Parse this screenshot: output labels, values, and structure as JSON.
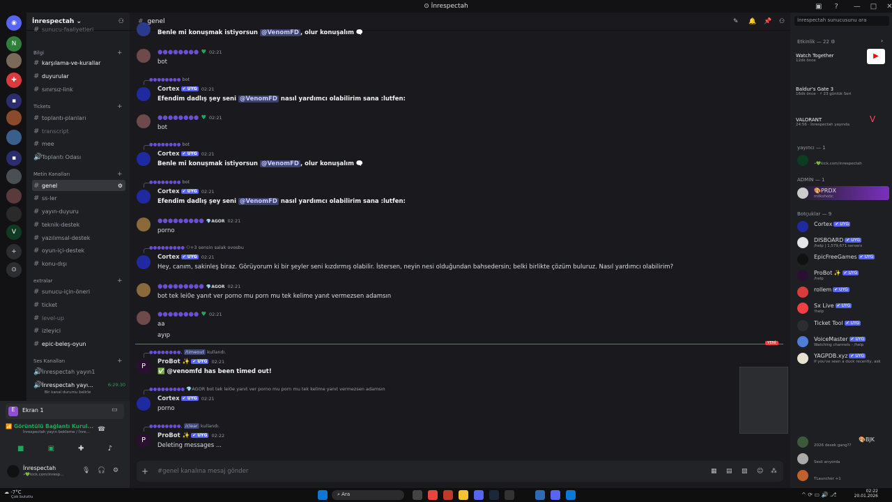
{
  "window": {
    "title": "İnrespectah"
  },
  "server": {
    "name": "İnrespectah ⌄",
    "search_placeholder": "İnrespectah sunucusunu ara"
  },
  "channels": {
    "cut_top": "sunucu-faaliyetleri",
    "categories": [
      {
        "name": "Bilgi",
        "items": [
          "karşılama-ve-kurallar",
          "duyurular",
          "sınırsız-link"
        ]
      },
      {
        "name": "Tickets",
        "items": [
          "toplantı-planları",
          "transcript",
          "mee",
          "Toplantı Odası"
        ]
      },
      {
        "name": "Metin Kanalları",
        "items": [
          "genel",
          "ss-ler",
          "yayın-duyuru",
          "teknik-destek",
          "yazılımsal-destek",
          "oyun-içi-destek",
          "konu-dışı"
        ]
      },
      {
        "name": "extralar",
        "items": [
          "sunucu-için-öneri",
          "ticket",
          "level-up",
          "izleyici",
          "epic-beleş-oyun"
        ]
      },
      {
        "name": "Ses Kanalları",
        "items": [
          "İnrespectah yayın1",
          "İnrespectah yayı..."
        ]
      }
    ],
    "voice_timer": "6:29:30",
    "voice_status": "Bir kanal durumu belirle"
  },
  "screen_share": {
    "label": "Ekran 1"
  },
  "voice_connected": {
    "title": "Görüntülü Bağlantı Kurul...",
    "subtitle": "İnrespectah yayın bekleme / İnre..."
  },
  "user": {
    "name": "İnrespectah",
    "status": "•💚kick.com/inresp..."
  },
  "chat": {
    "channel": "genel",
    "messages": [
      {
        "text": "Benle mi konuşmak istiyorsun ",
        "mention": "@VenomFD",
        "text2": ", olur konuşalım 🗨️"
      },
      {
        "time": "02:21",
        "text": "bot"
      },
      {
        "reply": "bot",
        "author": "Cortex",
        "badge": "✔ UYG",
        "time": "02:21",
        "text": "Efendim dadlış şey seni ",
        "mention": "@VenomFD",
        "text2": " nasıl yardımcı olabilirim sana :lutfen:"
      },
      {
        "time": "02:21",
        "text": "bot"
      },
      {
        "reply": "bot",
        "author": "Cortex",
        "badge": "✔ UYG",
        "time": "02:21",
        "text": "Benle mi konuşmak istiyorsun ",
        "mention": "@VenomFD",
        "text2": ", olur konuşalım 🗨️"
      },
      {
        "reply": "bot",
        "author": "Cortex",
        "badge": "✔ UYG",
        "time": "02:21",
        "text": "Efendim dadlış şey seni ",
        "mention": "@VenomFD",
        "text2": " nasıl yardımcı olabilirim sana :lutfen:"
      },
      {
        "tag": "💎AGOR",
        "time": "02:21",
        "text": "porno"
      },
      {
        "reply": "sensin salak ovosbu",
        "author": "Cortex",
        "badge": "✔ UYG",
        "time": "02:21",
        "text": "Hey, canım, sakinleş biraz. Görüyorum ki bir şeyler seni kızdırmış olabilir. İstersen, neyin nesi olduğundan bahsedersin; belki birlikte çözüm buluruz. Nasıl yardımcı olabilirim?"
      },
      {
        "tag": "💎AGOR",
        "time": "02:21",
        "text": "bot tek lei0e yanıt ver porno mu porn mu tek kelime yanıt vermezsen adamsın"
      },
      {
        "time": "02:21",
        "text": "aa",
        "text3": "ayıp"
      },
      {
        "reply_cmd": "/timeout",
        "reply_suffix": "kullandı.",
        "author": "ProBot ✨",
        "badge": "✔ UYG",
        "time": "02:21",
        "text": "✅ @venomfd has been timed out!"
      },
      {
        "reply": "bot tek lei0e yanıt ver porno mu porn mu tek kelime yanıt vermezsen adamsın",
        "reply_tag": "💎AGOR",
        "author": "Cortex",
        "badge": "✔ UYG",
        "time": "02:21",
        "text": "porno"
      },
      {
        "reply_cmd": "/clear",
        "reply_suffix": "kullandı.",
        "author": "ProBot ✨",
        "badge": "✔ UYG",
        "time": "02:22",
        "text": "Deleting messages ..."
      }
    ],
    "new_label": "YENİ",
    "composer_placeholder": "#genel kanalına mesaj gönder"
  },
  "members": {
    "activity_header": "Etkinlik — 22",
    "activities": [
      {
        "title": "Watch Together",
        "sub": "12dk önce"
      },
      {
        "title": "Baldur's Gate 3",
        "sub": "16dk önce · ⚡ 23 günlük Seri"
      },
      {
        "title": "VALORANT",
        "sub": "24:56 · İnrespectah yayında"
      }
    ],
    "groups": [
      {
        "name": "yayıncı — 1",
        "members": [
          {
            "name": "",
            "sub": "•💚kick.com/inrespectah"
          }
        ]
      },
      {
        "name": "ADMİN — 1",
        "members": [
          {
            "name": "🎨PRDX",
            "sub": "milkshoöc"
          }
        ]
      },
      {
        "name": "Botçuklar — 9",
        "members": [
          {
            "name": "Cortex",
            "sub": ""
          },
          {
            "name": "DISBOARD",
            "sub": "/help | 1,579,671 servers"
          },
          {
            "name": "EpicFreeGames",
            "sub": ""
          },
          {
            "name": "ProBot ✨",
            "sub": "/help"
          },
          {
            "name": "rollem",
            "sub": ""
          },
          {
            "name": "Sx Live",
            "sub": "!help"
          },
          {
            "name": "Ticket Tool",
            "sub": ""
          },
          {
            "name": "VoiceMaster",
            "sub": "Watching channels - /help"
          },
          {
            "name": "YAGPDB.xyz",
            "sub": "If you've seen a duck recently, ask"
          }
        ]
      }
    ],
    "bottom": [
      {
        "name": "🎨BJK",
        "sub": "2026 desek gang??"
      },
      {
        "name": "",
        "sub": "Sesli arıyorda"
      },
      {
        "name": "",
        "sub": "TLauncher +1"
      }
    ]
  },
  "taskbar": {
    "weather": "-7°C",
    "weather_sub": "Çok bulutlu",
    "search": "Ara",
    "time": "02:22",
    "date": "20.01.2026"
  },
  "colors": {
    "accent": "#5865f2",
    "mention_bg": "#3c4270",
    "new_line": "#f23f43"
  }
}
